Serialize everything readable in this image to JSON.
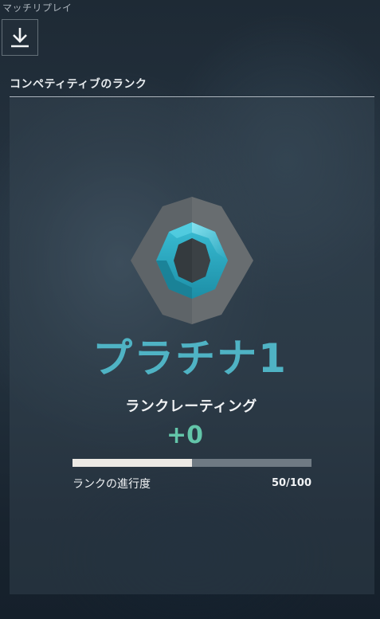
{
  "app": {
    "title": "マッチリプレイ"
  },
  "toolbar": {
    "download_icon": "download-icon"
  },
  "section": {
    "title": "コンペティティブのランク"
  },
  "rank": {
    "emblem_icon": "platinum-rank-icon",
    "name": "プラチナ1",
    "name_color": "#4fb3c4",
    "rating_label": "ランクレーティング",
    "rating_change": "+0",
    "rating_change_color": "#63c5a9"
  },
  "progress": {
    "label": "ランクの進行度",
    "value_text": "50/100",
    "current": 50,
    "max": 100,
    "fraction": 0.5
  }
}
